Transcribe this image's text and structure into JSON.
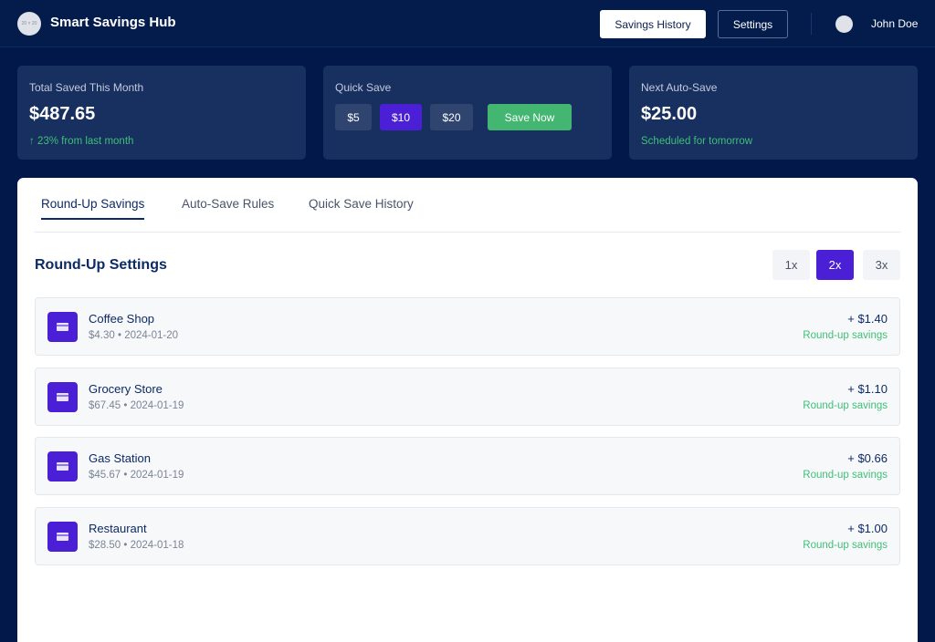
{
  "header": {
    "logo_text": "20 × 20",
    "app_title": "Smart Savings Hub",
    "nav": {
      "history_label": "Savings History",
      "settings_label": "Settings"
    },
    "user": {
      "name": "John Doe"
    }
  },
  "summary": {
    "total": {
      "label": "Total Saved This Month",
      "value": "$487.65",
      "change": "↑ 23% from last month"
    },
    "quick_save": {
      "label": "Quick Save",
      "amounts": [
        "$5",
        "$10",
        "$20"
      ],
      "selected": "$10",
      "action_label": "Save Now"
    },
    "next_auto": {
      "label": "Next Auto-Save",
      "value": "$25.00",
      "schedule": "Scheduled for tomorrow"
    }
  },
  "main": {
    "tabs": [
      {
        "label": "Round-Up Savings",
        "active": true
      },
      {
        "label": "Auto-Save Rules",
        "active": false
      },
      {
        "label": "Quick Save History",
        "active": false
      }
    ],
    "section_title": "Round-Up Settings",
    "multipliers": [
      "1x",
      "2x",
      "3x"
    ],
    "selected_multiplier": "2x",
    "transactions": [
      {
        "name": "Coffee Shop",
        "meta": "$4.30 • 2024-01-20",
        "savings": "+ $1.40",
        "tag": "Round-up savings"
      },
      {
        "name": "Grocery Store",
        "meta": "$67.45 • 2024-01-19",
        "savings": "+ $1.10",
        "tag": "Round-up savings"
      },
      {
        "name": "Gas Station",
        "meta": "$45.67 • 2024-01-19",
        "savings": "+ $0.66",
        "tag": "Round-up savings"
      },
      {
        "name": "Restaurant",
        "meta": "$28.50 • 2024-01-18",
        "savings": "+ $1.00",
        "tag": "Round-up savings"
      }
    ]
  },
  "colors": {
    "background": "#03184a",
    "card": "#17305f",
    "accent": "#4a1fd6",
    "success": "#43b672",
    "text_dark": "#0c2a66"
  },
  "icons": {
    "logo": "logo-placeholder",
    "transaction": "credit-card-icon"
  }
}
